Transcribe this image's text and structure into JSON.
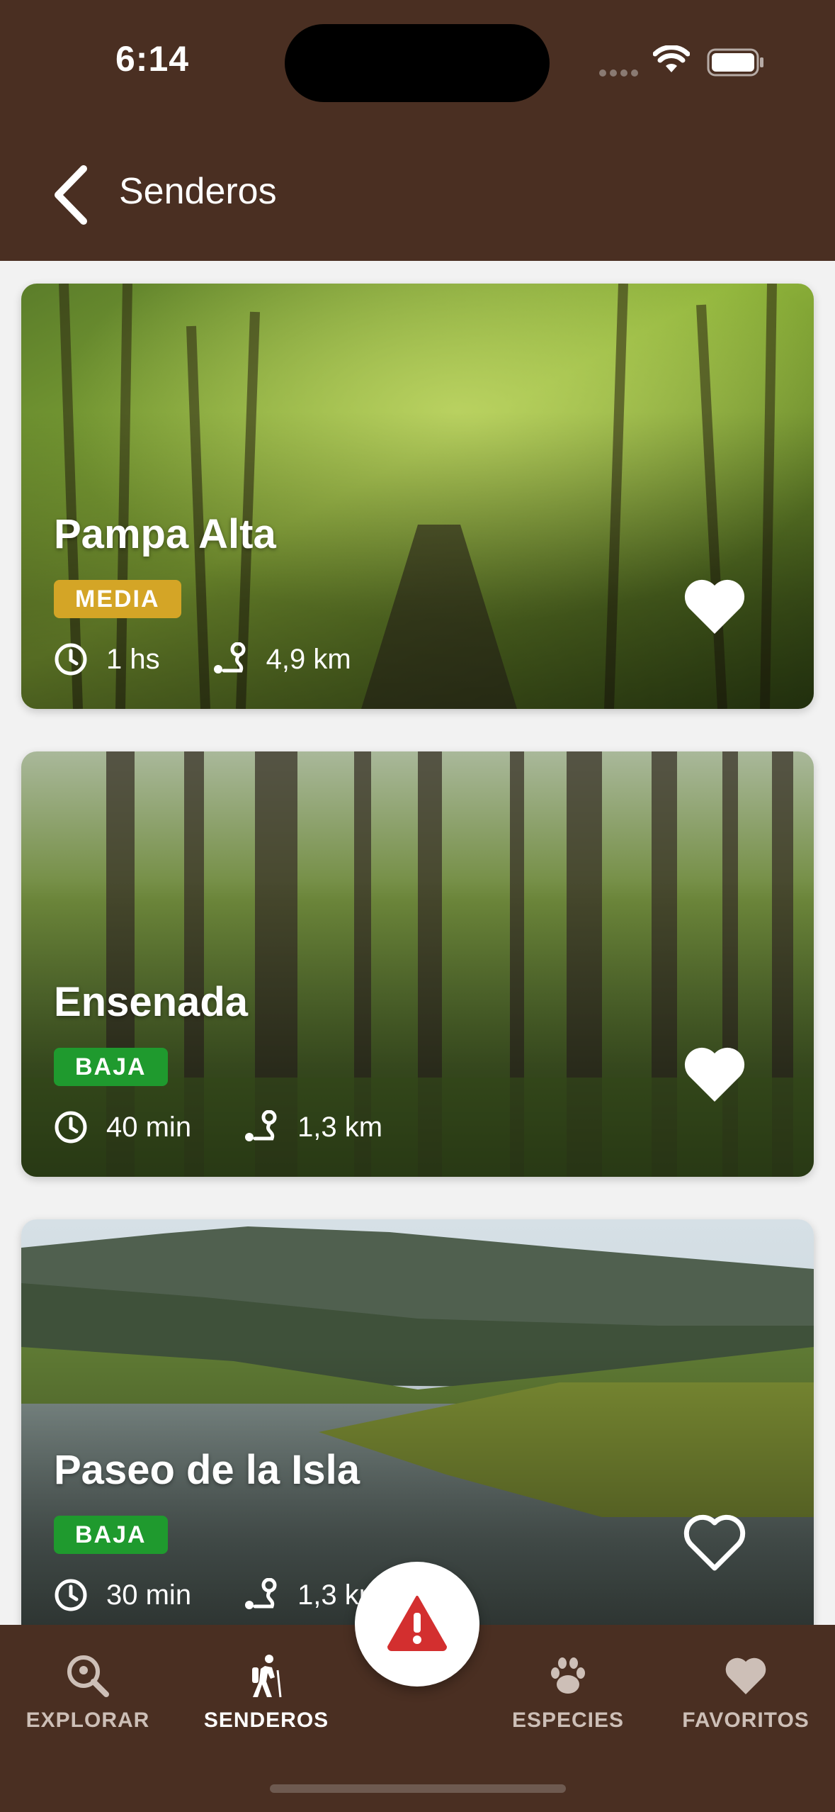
{
  "status_bar": {
    "time": "6:14"
  },
  "header": {
    "title": "Senderos",
    "back_icon": "chevron-left-icon"
  },
  "trails": [
    {
      "name": "Pampa Alta",
      "difficulty": "MEDIA",
      "difficulty_color": "#d4a526",
      "duration": "1 hs",
      "distance": "4,9 km",
      "favorite": true,
      "image": "green-forest-canopy"
    },
    {
      "name": "Ensenada",
      "difficulty": "BAJA",
      "difficulty_color": "#1f9a2e",
      "duration": "40 min",
      "distance": "1,3 km",
      "favorite": true,
      "image": "tall-forest-trunks"
    },
    {
      "name": "Paseo de la Isla",
      "difficulty": "BAJA",
      "difficulty_color": "#1f9a2e",
      "duration": "30 min",
      "distance": "1,3 km",
      "favorite": false,
      "image": "river-mountain-landscape"
    }
  ],
  "bottom_nav": {
    "items": [
      {
        "label": "EXPLORAR",
        "icon": "search-pin-icon",
        "active": false
      },
      {
        "label": "SENDEROS",
        "icon": "hiker-icon",
        "active": true
      },
      {
        "label": "ESPECIES",
        "icon": "paw-icon",
        "active": false
      },
      {
        "label": "FAVORITOS",
        "icon": "heart-icon",
        "active": false
      }
    ],
    "fab_icon": "warning-icon"
  },
  "colors": {
    "brand_brown": "#4a2f22",
    "alert_red": "#d32f2f"
  }
}
